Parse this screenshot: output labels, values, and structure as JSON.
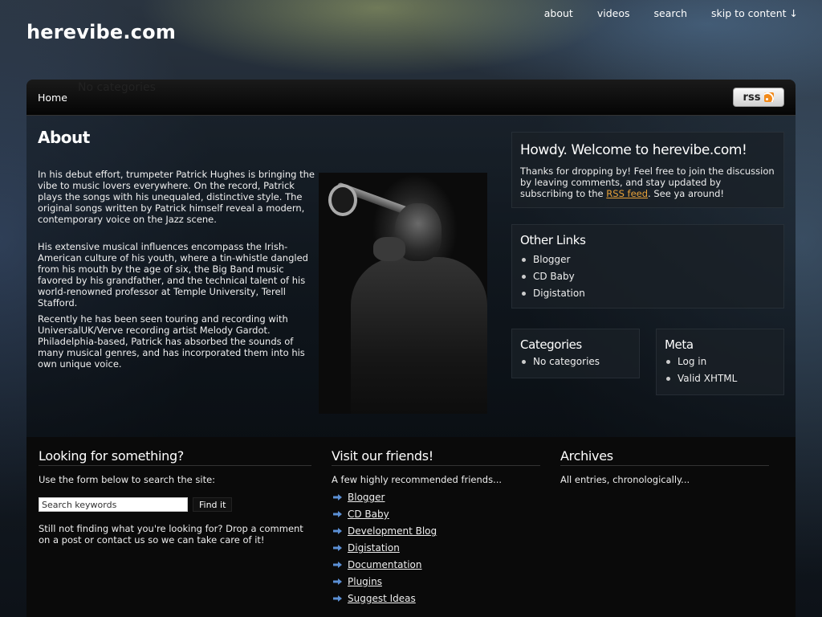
{
  "site": {
    "title": "herevibe.com"
  },
  "top_nav": [
    {
      "label": "about",
      "name": "nav-about"
    },
    {
      "label": "videos",
      "name": "nav-videos"
    },
    {
      "label": "search",
      "name": "nav-search"
    },
    {
      "label": "skip to content ↓",
      "name": "nav-skip-to-content"
    }
  ],
  "navbar": {
    "home_label": "Home",
    "overlap_text": "No categories",
    "rss_label": "rss"
  },
  "about": {
    "heading": "About",
    "paragraphs": [
      "In his debut effort, trumpeter Patrick Hughes is bringing the vibe to music lovers everywhere. On the record, Patrick plays the songs with his unequaled, distinctive style. The original songs written by Patrick himself reveal a modern, contemporary voice on the Jazz scene.",
      "His extensive musical influences encompass the Irish-American culture of his youth, where a tin-whistle dangled from his mouth by the age of six, the Big Band music favored by his grandfather, and the technical talent of his world-renowned professor at Temple University, Terell Stafford.",
      "Recently he has been seen touring and recording with UniversalUK/Verve recording artist Melody Gardot. Philadelphia-based, Patrick has absorbed the sounds of many musical genres, and has incorporated them into his own unique voice."
    ]
  },
  "welcome": {
    "heading": "Howdy. Welcome to herevibe.com!",
    "text_before": "Thanks for dropping by! Feel free to join the discussion by leaving comments, and stay updated by subscribing to the ",
    "link": "RSS feed",
    "text_after": ". See ya around!"
  },
  "other_links": {
    "heading": "Other Links",
    "items": [
      "Blogger",
      "CD Baby",
      "Digistation"
    ]
  },
  "categories": {
    "heading": "Categories",
    "items": [
      "No categories"
    ]
  },
  "meta": {
    "heading": "Meta",
    "items": [
      "Log in",
      "Valid XHTML"
    ]
  },
  "footer": {
    "search": {
      "heading": "Looking for something?",
      "intro": "Use the form below to search the site:",
      "placeholder": "Search keywords",
      "button": "Find it",
      "outro": "Still not finding what you're looking for? Drop a comment on a post or contact us so we can take care of it!"
    },
    "friends": {
      "heading": "Visit our friends!",
      "intro": "A few highly recommended friends...",
      "items": [
        "Blogger",
        "CD Baby",
        "Development Blog",
        "Digistation",
        "Documentation",
        "Plugins",
        "Suggest Ideas"
      ]
    },
    "archives": {
      "heading": "Archives",
      "intro": "All entries, chronologically..."
    }
  },
  "colors": {
    "link_accent": "#e8a23a",
    "arrow": "#5b8fd4",
    "rss_orange": "#f28a1a"
  },
  "icons": [
    "rss-icon",
    "arrow-right-icon"
  ]
}
